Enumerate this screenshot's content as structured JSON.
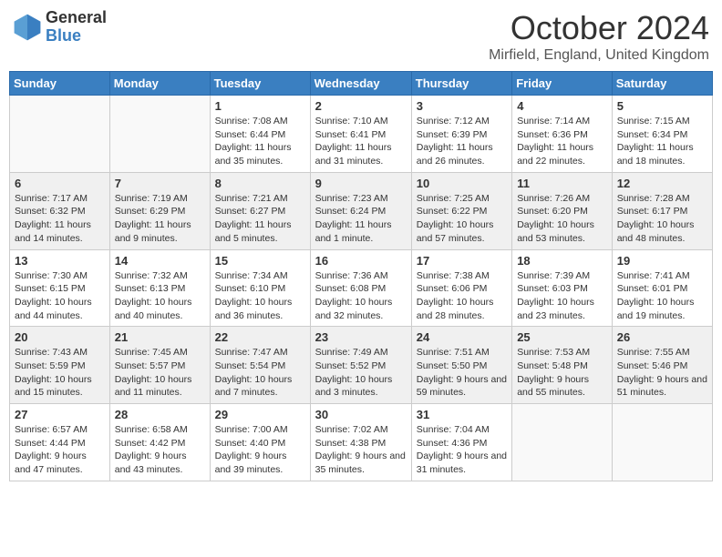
{
  "header": {
    "logo_general": "General",
    "logo_blue": "Blue",
    "month_title": "October 2024",
    "location": "Mirfield, England, United Kingdom"
  },
  "days_of_week": [
    "Sunday",
    "Monday",
    "Tuesday",
    "Wednesday",
    "Thursday",
    "Friday",
    "Saturday"
  ],
  "weeks": [
    [
      {
        "day": "",
        "info": ""
      },
      {
        "day": "",
        "info": ""
      },
      {
        "day": "1",
        "info": "Sunrise: 7:08 AM\nSunset: 6:44 PM\nDaylight: 11 hours and 35 minutes."
      },
      {
        "day": "2",
        "info": "Sunrise: 7:10 AM\nSunset: 6:41 PM\nDaylight: 11 hours and 31 minutes."
      },
      {
        "day": "3",
        "info": "Sunrise: 7:12 AM\nSunset: 6:39 PM\nDaylight: 11 hours and 26 minutes."
      },
      {
        "day": "4",
        "info": "Sunrise: 7:14 AM\nSunset: 6:36 PM\nDaylight: 11 hours and 22 minutes."
      },
      {
        "day": "5",
        "info": "Sunrise: 7:15 AM\nSunset: 6:34 PM\nDaylight: 11 hours and 18 minutes."
      }
    ],
    [
      {
        "day": "6",
        "info": "Sunrise: 7:17 AM\nSunset: 6:32 PM\nDaylight: 11 hours and 14 minutes."
      },
      {
        "day": "7",
        "info": "Sunrise: 7:19 AM\nSunset: 6:29 PM\nDaylight: 11 hours and 9 minutes."
      },
      {
        "day": "8",
        "info": "Sunrise: 7:21 AM\nSunset: 6:27 PM\nDaylight: 11 hours and 5 minutes."
      },
      {
        "day": "9",
        "info": "Sunrise: 7:23 AM\nSunset: 6:24 PM\nDaylight: 11 hours and 1 minute."
      },
      {
        "day": "10",
        "info": "Sunrise: 7:25 AM\nSunset: 6:22 PM\nDaylight: 10 hours and 57 minutes."
      },
      {
        "day": "11",
        "info": "Sunrise: 7:26 AM\nSunset: 6:20 PM\nDaylight: 10 hours and 53 minutes."
      },
      {
        "day": "12",
        "info": "Sunrise: 7:28 AM\nSunset: 6:17 PM\nDaylight: 10 hours and 48 minutes."
      }
    ],
    [
      {
        "day": "13",
        "info": "Sunrise: 7:30 AM\nSunset: 6:15 PM\nDaylight: 10 hours and 44 minutes."
      },
      {
        "day": "14",
        "info": "Sunrise: 7:32 AM\nSunset: 6:13 PM\nDaylight: 10 hours and 40 minutes."
      },
      {
        "day": "15",
        "info": "Sunrise: 7:34 AM\nSunset: 6:10 PM\nDaylight: 10 hours and 36 minutes."
      },
      {
        "day": "16",
        "info": "Sunrise: 7:36 AM\nSunset: 6:08 PM\nDaylight: 10 hours and 32 minutes."
      },
      {
        "day": "17",
        "info": "Sunrise: 7:38 AM\nSunset: 6:06 PM\nDaylight: 10 hours and 28 minutes."
      },
      {
        "day": "18",
        "info": "Sunrise: 7:39 AM\nSunset: 6:03 PM\nDaylight: 10 hours and 23 minutes."
      },
      {
        "day": "19",
        "info": "Sunrise: 7:41 AM\nSunset: 6:01 PM\nDaylight: 10 hours and 19 minutes."
      }
    ],
    [
      {
        "day": "20",
        "info": "Sunrise: 7:43 AM\nSunset: 5:59 PM\nDaylight: 10 hours and 15 minutes."
      },
      {
        "day": "21",
        "info": "Sunrise: 7:45 AM\nSunset: 5:57 PM\nDaylight: 10 hours and 11 minutes."
      },
      {
        "day": "22",
        "info": "Sunrise: 7:47 AM\nSunset: 5:54 PM\nDaylight: 10 hours and 7 minutes."
      },
      {
        "day": "23",
        "info": "Sunrise: 7:49 AM\nSunset: 5:52 PM\nDaylight: 10 hours and 3 minutes."
      },
      {
        "day": "24",
        "info": "Sunrise: 7:51 AM\nSunset: 5:50 PM\nDaylight: 9 hours and 59 minutes."
      },
      {
        "day": "25",
        "info": "Sunrise: 7:53 AM\nSunset: 5:48 PM\nDaylight: 9 hours and 55 minutes."
      },
      {
        "day": "26",
        "info": "Sunrise: 7:55 AM\nSunset: 5:46 PM\nDaylight: 9 hours and 51 minutes."
      }
    ],
    [
      {
        "day": "27",
        "info": "Sunrise: 6:57 AM\nSunset: 4:44 PM\nDaylight: 9 hours and 47 minutes."
      },
      {
        "day": "28",
        "info": "Sunrise: 6:58 AM\nSunset: 4:42 PM\nDaylight: 9 hours and 43 minutes."
      },
      {
        "day": "29",
        "info": "Sunrise: 7:00 AM\nSunset: 4:40 PM\nDaylight: 9 hours and 39 minutes."
      },
      {
        "day": "30",
        "info": "Sunrise: 7:02 AM\nSunset: 4:38 PM\nDaylight: 9 hours and 35 minutes."
      },
      {
        "day": "31",
        "info": "Sunrise: 7:04 AM\nSunset: 4:36 PM\nDaylight: 9 hours and 31 minutes."
      },
      {
        "day": "",
        "info": ""
      },
      {
        "day": "",
        "info": ""
      }
    ]
  ]
}
